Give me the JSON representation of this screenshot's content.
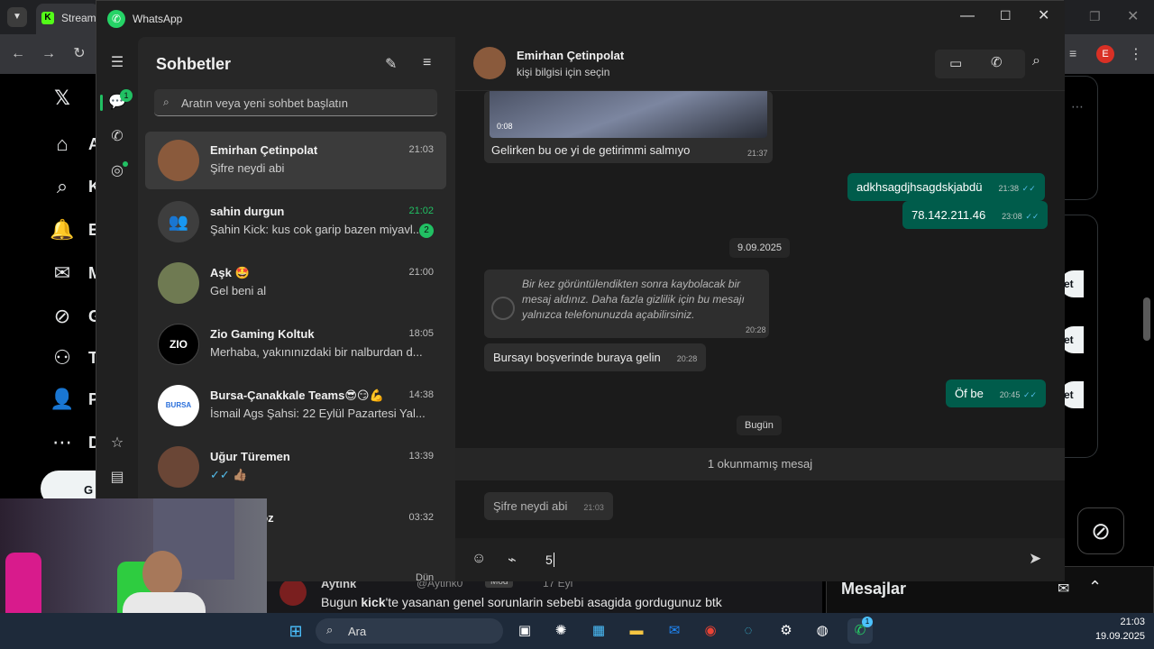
{
  "browser": {
    "tab_title": "Stream",
    "profile_initial": "E",
    "x_nav_letters": [
      "A",
      "K",
      "E",
      "M",
      "G",
      "T",
      "P",
      "D"
    ],
    "x_button_letter": "G",
    "pill_label": "et",
    "stream_overlay": {
      "user": "Aytink",
      "handle": "@Aytink0",
      "badge": "Mod",
      "date": "17 Eyl",
      "msg_pre": "Bugun ",
      "msg_bold": "kick",
      "msg_post": "'te yasanan genel sorunlarin sebebi asagida gordugunuz btk",
      "messages_label": "Mesajlar"
    }
  },
  "whatsapp": {
    "app_title": "WhatsApp",
    "rail_badge": "1",
    "list": {
      "heading": "Sohbetler",
      "search_placeholder": "Aratın veya yeni sohbet başlatın",
      "chats": [
        {
          "name": "Emirhan Çetinpolat",
          "preview": "Şifre neydi abi",
          "time": "21:03",
          "unread": ""
        },
        {
          "name": "sahin durgun",
          "preview": "Şahin Kick: kus cok garip bazen miyavl...",
          "time": "21:02",
          "unread": "2"
        },
        {
          "name": "Aşk 🤩",
          "preview": "Gel beni al",
          "time": "21:00",
          "unread": ""
        },
        {
          "name": "Zio Gaming Koltuk",
          "preview": "Merhaba, yakınınızdaki bir nalburdan d...",
          "time": "18:05",
          "unread": ""
        },
        {
          "name": "Bursa-Çanakkale Teams😎😏💪",
          "preview": "İsmail Ags Şahsi: 22 Eylül Pazartesi Yal...",
          "time": "14:38",
          "unread": ""
        },
        {
          "name": "Uğur Türemen",
          "preview": "✓✓ 👍🏽",
          "time": "13:39",
          "unread": ""
        },
        {
          "name": "ragoz",
          "preview": "",
          "time": "03:32",
          "unread": ""
        }
      ],
      "last_time": "Dün",
      "zio_logo": "ZIO",
      "bursa_logo": "BURSA"
    },
    "chat": {
      "contact_name": "Emirhan Çetinpolat",
      "contact_sub": "kişi bilgisi için seçin",
      "video_duration": "0:08",
      "messages": [
        {
          "text": "Gelirken bu oe yi de getirimmi salmıyo",
          "time": "21:37"
        },
        {
          "text": "adkhsagdjhsagdskjabdü",
          "time": "21:38"
        },
        {
          "text": "78.142.211.46",
          "time": "23:08"
        },
        {
          "text": "Bursayı boşverinde buraya gelin",
          "time": "20:28"
        },
        {
          "text": "Öf be",
          "time": "20:45"
        },
        {
          "text": "Şifre neydi abi",
          "time": "21:03"
        }
      ],
      "date_1": "9.09.2025",
      "view_once_text": "Bir kez görüntülendikten sonra kaybolacak bir mesaj aldınız. Daha fazla gizlilik için bu mesajı yalnızca telefonunuzda açabilirsiniz.",
      "view_once_time": "20:28",
      "date_2": "Bugün",
      "unread_divider": "1 okunmamış mesaj",
      "input_value": "5"
    }
  },
  "taskbar": {
    "search_label": "Ara",
    "time": "21:03",
    "date": "19.09.2025",
    "wa_badge": "1"
  },
  "colors": {
    "accent_green": "#21c063",
    "outgoing_bubble": "#005c4b",
    "read_tick": "#53bdeb"
  }
}
